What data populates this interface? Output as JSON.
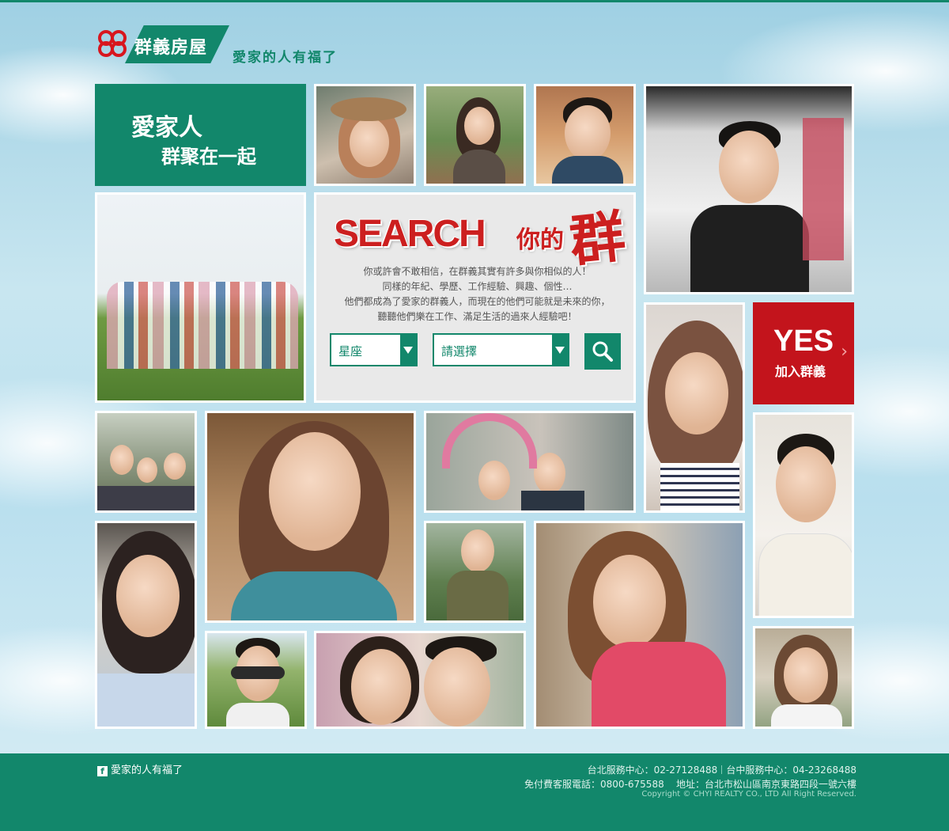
{
  "header": {
    "logo_name": "群義房屋",
    "slogan": "愛家的人有福了"
  },
  "intro_tile": {
    "line1": "愛家人",
    "line2": "群聚在一起"
  },
  "search": {
    "title_en": "SEARCH",
    "title_zh_small": "你的",
    "title_zh_big": "群",
    "description": [
      "你或許會不敢相信，在群義其實有許多與你相似的人！",
      "同樣的年紀、學歷、工作經驗、興趣、個性…",
      "他們都成為了愛家的群義人，而現在的他們可能就是未來的你，",
      "聽聽他們樂在工作、滿足生活的過來人經驗吧！"
    ],
    "select1_value": "星座",
    "select2_value": "請選擇"
  },
  "join": {
    "big": "YES",
    "small": "加入群義",
    "chevron": "›"
  },
  "footer": {
    "fb_label": "愛家的人有福了",
    "taipei": "台北服務中心：02-27128488",
    "taichung": "台中服務中心：04-23268488",
    "hotline": "免付費客服電話：0800-675588",
    "address": "地址：台北市松山區南京東路四段一號六樓",
    "copyright": "Copyright © CHYI REALTY CO., LTD All Right Reserved."
  },
  "colors": {
    "brand_green": "#12876b",
    "accent_red": "#c3141c"
  }
}
